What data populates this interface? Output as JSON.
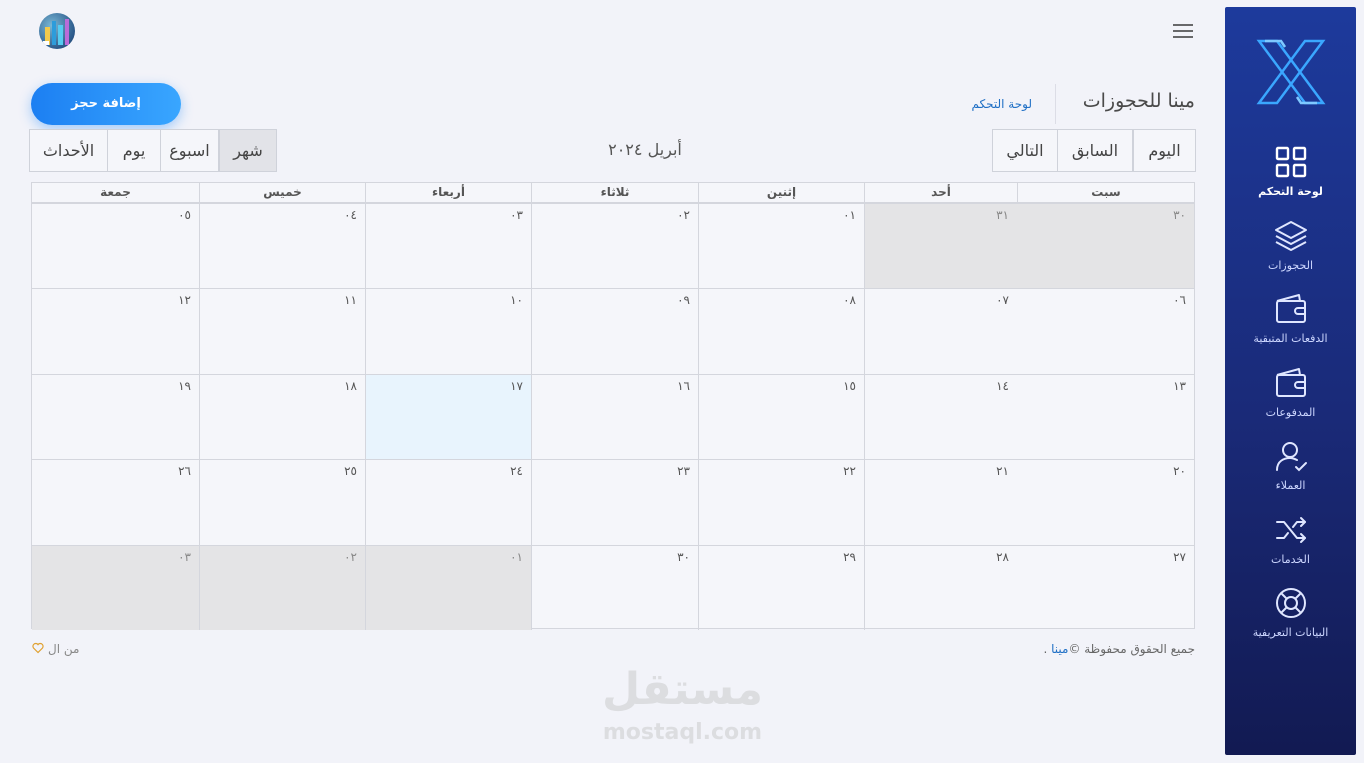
{
  "topbar": {
    "avatar_alt": "avatar",
    "menu_icon": "hamburger-icon"
  },
  "header": {
    "title": "مينا للحجوزات",
    "breadcrumb": "لوحة التحكم",
    "add_button": "إضافة حجز"
  },
  "toolbar": {
    "nav_buttons": [
      "اليوم",
      "السابق",
      "التالي"
    ],
    "month_title": "أبريل ٢٠٢٤",
    "view_buttons": [
      "شهر",
      "اسبوع",
      "يوم",
      "الأحداث"
    ],
    "active_view": "شهر"
  },
  "sidebar": {
    "items": [
      {
        "label": "لوحة التحكم",
        "icon": "grid-icon",
        "active": true
      },
      {
        "label": "الحجوزات",
        "icon": "layers-icon"
      },
      {
        "label": "الدفعات المتبقية",
        "icon": "wallet-icon"
      },
      {
        "label": "المدفوعات",
        "icon": "wallet-icon"
      },
      {
        "label": "العملاء",
        "icon": "user-check-icon"
      },
      {
        "label": "الخدمات",
        "icon": "shuffle-icon"
      },
      {
        "label": "البيانات التعريفية",
        "icon": "lifebuoy-icon"
      }
    ]
  },
  "calendar": {
    "weekdays": [
      "سبت",
      "أحد",
      "إثنين",
      "ثلاثاء",
      "أربعاء",
      "خميس",
      "جمعة"
    ],
    "weeks": [
      [
        {
          "d": "٣٠",
          "other": true
        },
        {
          "d": "٣١",
          "other": true
        },
        {
          "d": "٠١"
        },
        {
          "d": "٠٢"
        },
        {
          "d": "٠٣"
        },
        {
          "d": "٠٤"
        },
        {
          "d": "٠٥"
        }
      ],
      [
        {
          "d": "٠٦"
        },
        {
          "d": "٠٧"
        },
        {
          "d": "٠٨"
        },
        {
          "d": "٠٩"
        },
        {
          "d": "١٠"
        },
        {
          "d": "١١"
        },
        {
          "d": "١٢"
        }
      ],
      [
        {
          "d": "١٣"
        },
        {
          "d": "١٤"
        },
        {
          "d": "١٥"
        },
        {
          "d": "١٦"
        },
        {
          "d": "١٧",
          "today": true
        },
        {
          "d": "١٨"
        },
        {
          "d": "١٩"
        }
      ],
      [
        {
          "d": "٢٠"
        },
        {
          "d": "٢١"
        },
        {
          "d": "٢٢"
        },
        {
          "d": "٢٣"
        },
        {
          "d": "٢٤"
        },
        {
          "d": "٢٥"
        },
        {
          "d": "٢٦"
        }
      ],
      [
        {
          "d": "٢٧"
        },
        {
          "d": "٢٨"
        },
        {
          "d": "٢٩"
        },
        {
          "d": "٣٠"
        },
        {
          "d": "٠١",
          "other": true
        },
        {
          "d": "٠٢",
          "other": true
        },
        {
          "d": "٠٣",
          "other": true
        }
      ]
    ]
  },
  "footer": {
    "copyright": "جميع الحقوق محفوظة ©",
    "brand": "مينا",
    "dot": " .",
    "made_by": "من ال"
  },
  "watermark": {
    "arabic": "مستقل",
    "latin": "mostaql.com"
  }
}
